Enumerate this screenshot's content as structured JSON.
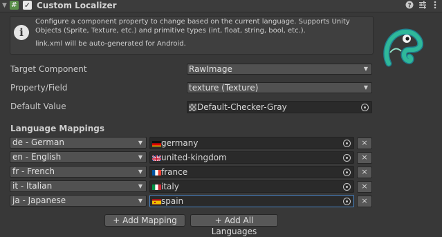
{
  "header": {
    "title": "Custom Localizer",
    "enabled_mark": "✓",
    "script_glyph": "#",
    "icons": [
      "help-icon",
      "preset-icon",
      "kebab-menu-icon"
    ]
  },
  "help": {
    "line1": "Configure a component property to change based on the current language. Supports Unity Objects (Sprite, Texture, etc.) and primitive types (int, float, string, bool, etc.).",
    "line2": "link.xml will be auto-generated for Android."
  },
  "fields": {
    "target_component": {
      "label": "Target Component",
      "value": "RawImage"
    },
    "property_field": {
      "label": "Property/Field",
      "value": "texture (Texture)"
    },
    "default_value": {
      "label": "Default Value",
      "value": "Default-Checker-Gray"
    }
  },
  "mappings": {
    "title": "Language Mappings",
    "rows": [
      {
        "language": "de - German",
        "asset": "germany",
        "flag": "germany"
      },
      {
        "language": "en - English",
        "asset": "united-kingdom",
        "flag": "united-kingdom"
      },
      {
        "language": "fr - French",
        "asset": "france",
        "flag": "france"
      },
      {
        "language": "it - Italian",
        "asset": "italy",
        "flag": "italy"
      },
      {
        "language": "ja - Japanese",
        "asset": "spain",
        "flag": "spain"
      }
    ],
    "remove_label": "×"
  },
  "buttons": {
    "add_mapping": "+ Add Mapping",
    "add_all": "+ Add All Languages"
  },
  "colors": {
    "accent_focus": "#4a86c8",
    "background": "#383838",
    "mascot": "#2fb89a"
  }
}
